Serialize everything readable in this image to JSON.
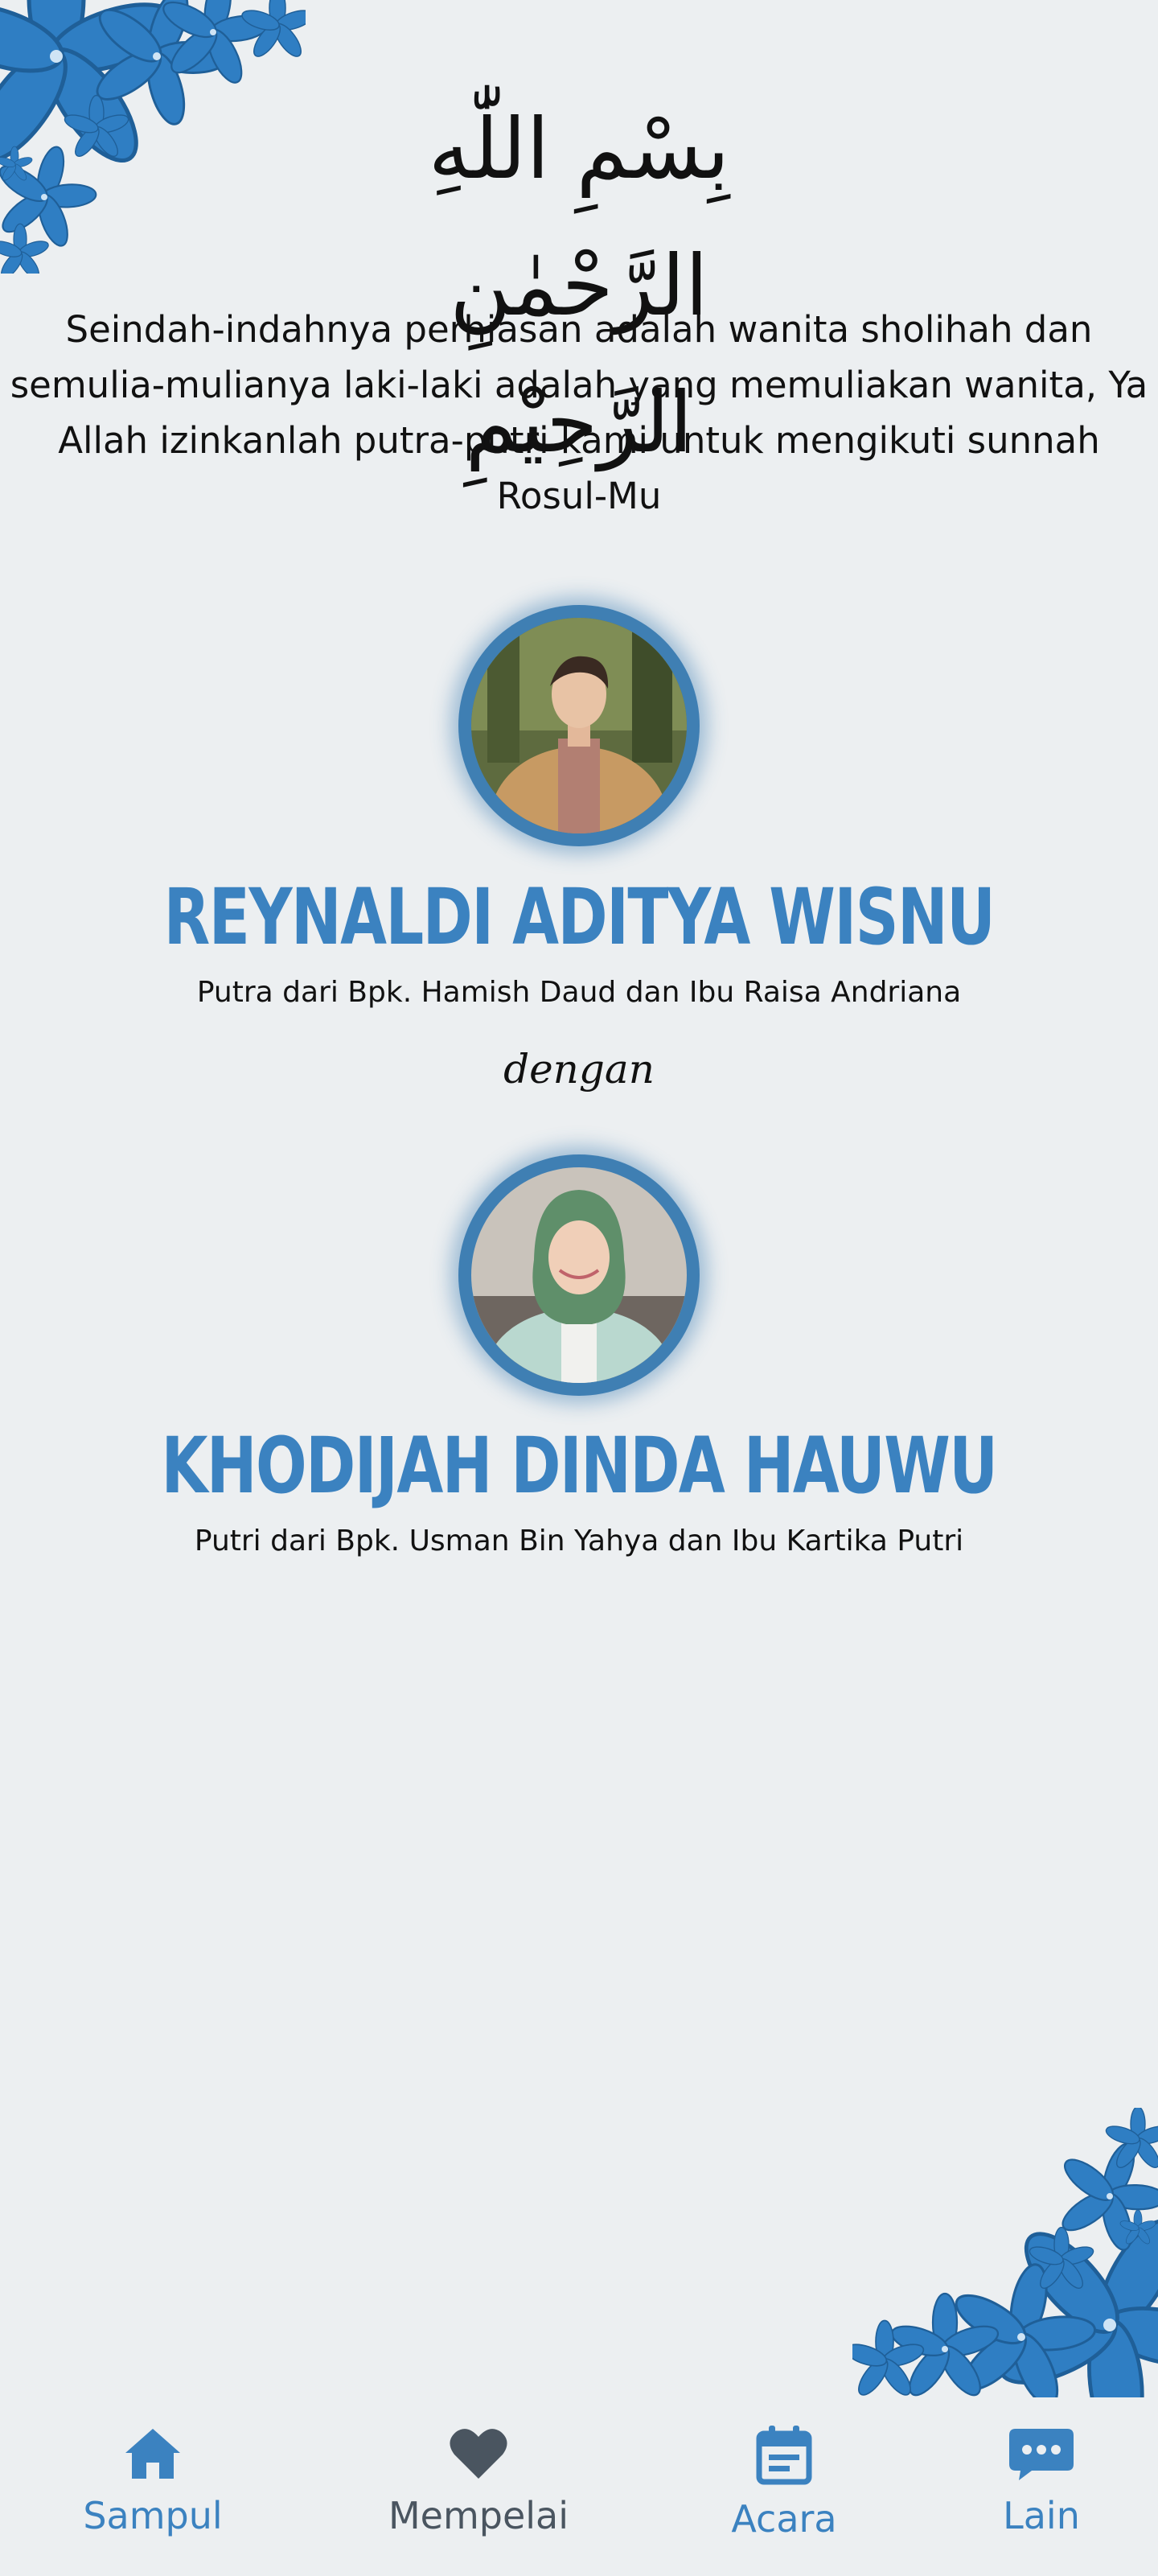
{
  "header": {
    "bismillah": "بِسْمِ اللّٰهِ الرَّحْمٰنِ الرَّحِيْمِ",
    "quote": "Seindah-indahnya perhiasan adalah wanita sholihah dan semulia-mulianya laki-laki adalah yang memuliakan wanita, Ya Allah izinkanlah putra-putri kami untuk mengikuti sunnah Rosul-Mu"
  },
  "groom": {
    "name": "REYNALDI ADITYA WISNU",
    "parents": "Putra dari Bpk. Hamish Daud dan Ibu Raisa Andriana"
  },
  "conjunction": "dengan",
  "bride": {
    "name": "KHODIJAH DINDA HAUWU",
    "parents": "Putri dari Bpk. Usman Bin Yahya dan Ibu Kartika Putri"
  },
  "nav": {
    "items": [
      {
        "label": "Sampul",
        "icon": "home-icon",
        "color": "#3b82c0"
      },
      {
        "label": "Mempelai",
        "icon": "heart-icon",
        "color": "#4a5560",
        "active": true
      },
      {
        "label": "Acara",
        "icon": "calendar-icon",
        "color": "#3b82c0"
      },
      {
        "label": "Lain",
        "icon": "more-icon",
        "color": "#3b82c0"
      }
    ]
  },
  "colors": {
    "accent": "#3b82c0",
    "frame": "#3f7fb3",
    "background": "#eceff1",
    "active_nav": "#4a5560"
  }
}
